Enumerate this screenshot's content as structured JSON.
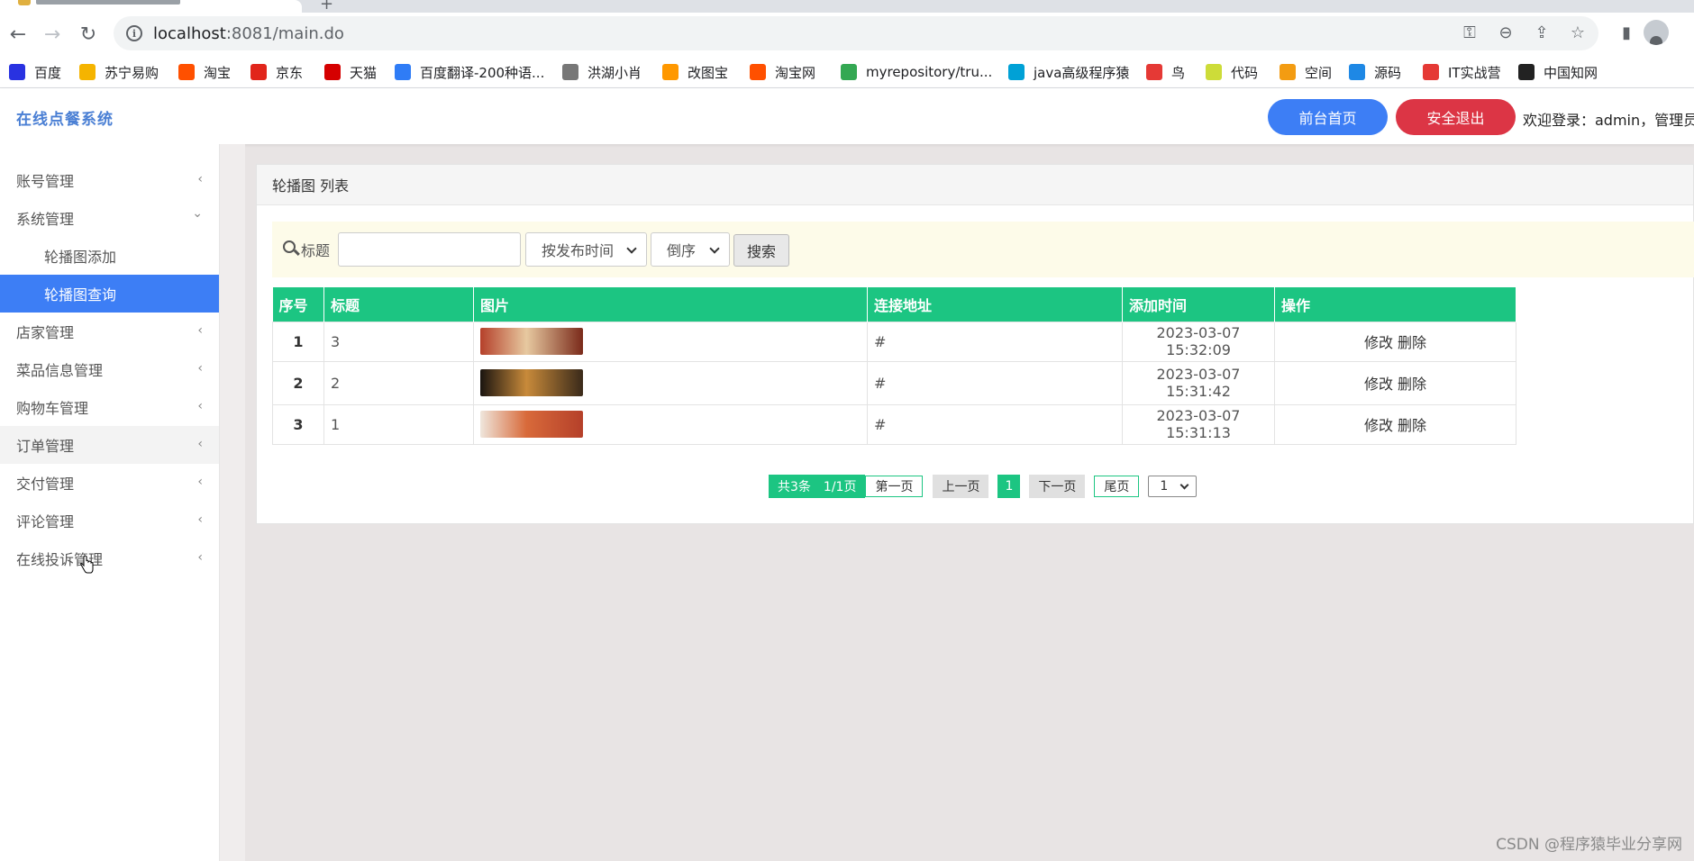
{
  "browser": {
    "url_host": "localhost",
    "url_rest": ":8081/main.do",
    "bookmarks": [
      {
        "label": "百度",
        "icon": "baidu-icon",
        "color": "#2932e1"
      },
      {
        "label": "苏宁易购",
        "icon": "suning-icon",
        "color": "#f5b400"
      },
      {
        "label": "淘宝",
        "icon": "taobao-icon",
        "color": "#ff5000"
      },
      {
        "label": "京东",
        "icon": "jd-icon",
        "color": "#e1251b"
      },
      {
        "label": "天猫",
        "icon": "tmall-icon",
        "color": "#d50000"
      },
      {
        "label": "百度翻译-200种语...",
        "icon": "translate-icon",
        "color": "#2f7cf6"
      },
      {
        "label": "洪湖小肖",
        "icon": "hongu-icon",
        "color": "#777777"
      },
      {
        "label": "改图宝",
        "icon": "gaitubao-icon",
        "color": "#ff9800"
      },
      {
        "label": "淘宝网",
        "icon": "taobao-icon",
        "color": "#ff5000"
      },
      {
        "label": "myrepository/tru...",
        "icon": "chrome-icon",
        "color": "#34a853"
      },
      {
        "label": "java高级程序猿",
        "icon": "bilibili-icon",
        "color": "#00a1d6"
      },
      {
        "label": "鸟",
        "icon": "bird-icon",
        "color": "#e53935"
      },
      {
        "label": "代码",
        "icon": "code-icon",
        "color": "#cddc39"
      },
      {
        "label": "空间",
        "icon": "space-icon",
        "color": "#f39c12"
      },
      {
        "label": "源码",
        "icon": "fish-icon",
        "color": "#1e88e5"
      },
      {
        "label": "IT实战营",
        "icon": "it-icon",
        "color": "#e53935"
      },
      {
        "label": "中国知网",
        "icon": "cnki-icon",
        "color": "#222222"
      }
    ]
  },
  "header": {
    "brand": "在线点餐系统",
    "home_button": "前台首页",
    "logout_button": "安全退出",
    "welcome": "欢迎登录：admin，管理员"
  },
  "sidebar": {
    "items": [
      {
        "label": "账号管理",
        "chevron": "‹"
      },
      {
        "label": "系统管理",
        "chevron": "⌄"
      },
      {
        "label": "轮播图添加"
      },
      {
        "label": "轮播图查询"
      },
      {
        "label": "店家管理",
        "chevron": "‹"
      },
      {
        "label": "菜品信息管理",
        "chevron": "‹"
      },
      {
        "label": "购物车管理",
        "chevron": "‹"
      },
      {
        "label": "订单管理",
        "chevron": "‹"
      },
      {
        "label": "交付管理",
        "chevron": "‹"
      },
      {
        "label": "评论管理",
        "chevron": "‹"
      },
      {
        "label": "在线投诉管理",
        "chevron": "‹"
      }
    ]
  },
  "panel": {
    "title": "轮播图 列表",
    "search": {
      "label": "标题",
      "value": "",
      "sort_field": "按发布时间",
      "sort_order": "倒序",
      "button": "搜索"
    },
    "table": {
      "headers": [
        "序号",
        "标题",
        "图片",
        "连接地址",
        "添加时间",
        "操作"
      ],
      "rows": [
        {
          "no": "1",
          "title": "3",
          "link": "#",
          "time": "2023-03-07 15:32:09",
          "edit": "修改",
          "delete": "删除",
          "thumb": [
            "#b5402a",
            "#e7c9a0",
            "#7a2a1a"
          ]
        },
        {
          "no": "2",
          "title": "2",
          "link": "#",
          "time": "2023-03-07 15:31:42",
          "edit": "修改",
          "delete": "删除",
          "thumb": [
            "#1a1410",
            "#c88a3a",
            "#3a2a1a"
          ]
        },
        {
          "no": "3",
          "title": "1",
          "link": "#",
          "time": "2023-03-07 15:31:13",
          "edit": "修改",
          "delete": "删除",
          "thumb": [
            "#efe6dc",
            "#d86a3a",
            "#b5402a"
          ]
        }
      ]
    },
    "pager": {
      "total": "共3条",
      "pages": "1/1页",
      "first": "第一页",
      "prev": "上一页",
      "current": "1",
      "next": "下一页",
      "last": "尾页",
      "jump_value": "1"
    }
  },
  "watermark": "CSDN @程序猿毕业分享网"
}
